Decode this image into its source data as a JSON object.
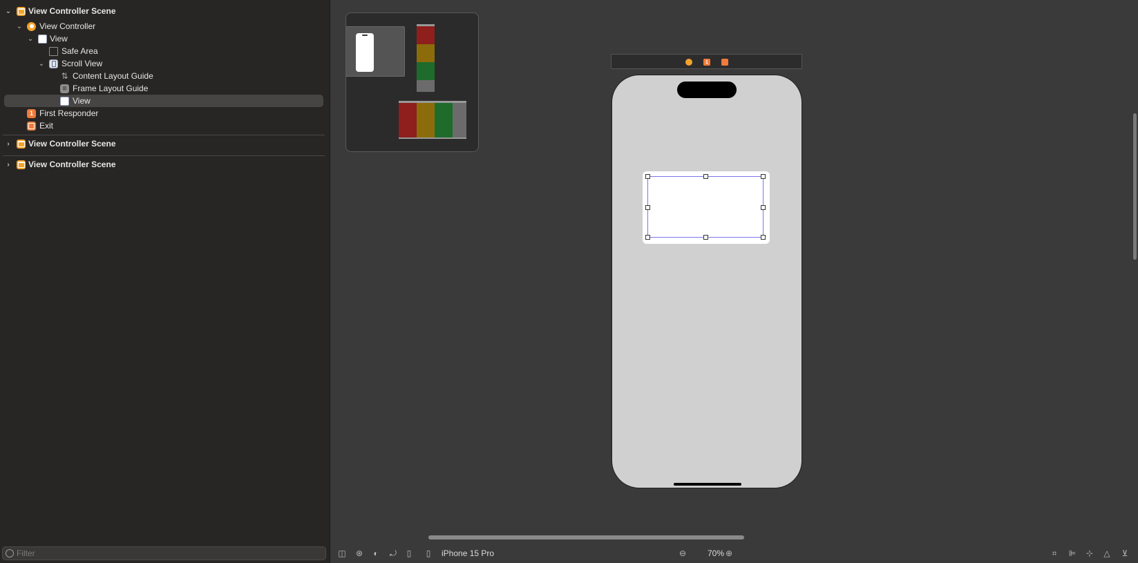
{
  "outline": {
    "scene1": {
      "title": "View Controller Scene",
      "items": [
        {
          "label": "View Controller",
          "icon": "view-controller-icon"
        },
        {
          "label": "View",
          "icon": "view-icon"
        },
        {
          "label": "Safe Area",
          "icon": "safe-area-icon"
        },
        {
          "label": "Scroll View",
          "icon": "scroll-view-icon"
        },
        {
          "label": "Content Layout Guide",
          "icon": "layout-guide-icon"
        },
        {
          "label": "Frame Layout Guide",
          "icon": "frame-layout-guide-icon"
        },
        {
          "label": "View",
          "icon": "view-icon",
          "selected": true
        },
        {
          "label": "First Responder",
          "icon": "first-responder-icon"
        },
        {
          "label": "Exit",
          "icon": "exit-icon"
        }
      ]
    },
    "scene2": {
      "title": "View Controller Scene"
    },
    "scene3": {
      "title": "View Controller Scene"
    }
  },
  "filter": {
    "placeholder": "Filter"
  },
  "toolbar": {
    "device": "iPhone 15 Pro",
    "zoom": "70%"
  },
  "minimap": {
    "vstack_colors": [
      "#8e1f1c",
      "#8c6c0a",
      "#1f6b2c",
      "#6b6b6b"
    ],
    "hstack_colors": [
      "#8e1f1c",
      "#8c6c0a",
      "#1f6b2c",
      "#6b6b6b"
    ]
  },
  "colors": {
    "accent": "#f2a32a",
    "responder": "#f07b3a",
    "selection": "#7b74e8",
    "device_bg": "#d0d0d0"
  }
}
